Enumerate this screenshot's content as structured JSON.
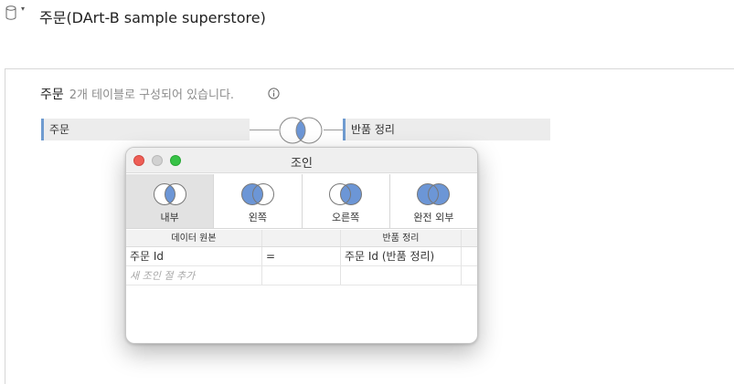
{
  "header": {
    "icon": "database-icon",
    "title": "주문(DArt-B sample superstore)"
  },
  "canvas": {
    "name": "주문",
    "description": "2개 테이블로 구성되어 있습니다.",
    "left_table": "주문",
    "right_table": "반품 정리"
  },
  "dialog": {
    "title": "조인",
    "join_types": [
      {
        "label": "내부",
        "selected": true
      },
      {
        "label": "왼쪽",
        "selected": false
      },
      {
        "label": "오른쪽",
        "selected": false
      },
      {
        "label": "완전 외부",
        "selected": false
      }
    ],
    "columns": [
      "데이터 원본",
      "",
      "반품 정리"
    ],
    "clauses": [
      {
        "left": "주문 Id",
        "op": "=",
        "right": "주문 Id (반품 정리)"
      }
    ],
    "new_clause_placeholder": "새 조인 절 추가"
  },
  "colors": {
    "accent": "#6f9bd0",
    "venn_fill": "#6c96d6"
  }
}
